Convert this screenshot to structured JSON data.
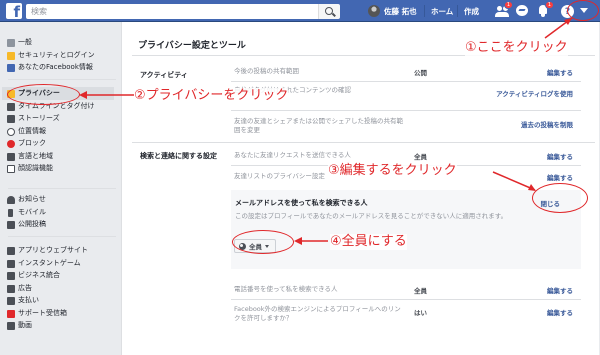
{
  "topbar": {
    "search_placeholder": "検索",
    "user_name": "佐藤 拓也",
    "home": "ホーム",
    "create": "作成",
    "friend_badge": "1",
    "notif_badge": "1",
    "help": "?"
  },
  "sidebar": {
    "group1": [
      "一般",
      "セキュリティとログイン",
      "あなたのFacebook情報"
    ],
    "group2": [
      "プライバシー",
      "タイムラインとタグ付け",
      "ストーリーズ",
      "位置情報",
      "ブロック",
      "言語と地域",
      "顔認識機能"
    ],
    "group3": [
      "お知らせ",
      "モバイル",
      "公開投稿"
    ],
    "group4": [
      "アプリとウェブサイト",
      "インスタントゲーム",
      "ビジネス統合",
      "広告",
      "支払い",
      "サポート受信箱",
      "動画"
    ]
  },
  "main": {
    "title": "プライバシー設定とツール",
    "activity": {
      "label": "アクティビティ",
      "rows": [
        {
          "q": "今後の投稿の共有範囲",
          "v": "公開",
          "a": "編集する"
        },
        {
          "q": "自分がタグ付けされたコンテンツの確認",
          "v": "",
          "a": "アクティビティログを使用"
        },
        {
          "q": "友達の友達とシェアまたは公開でシェアした投稿の共有範囲を変更",
          "v": "",
          "a": "過去の投稿を制限"
        }
      ]
    },
    "search_contact": {
      "label": "検索と連絡に関する設定",
      "rows": [
        {
          "q": "あなたに友達リクエストを送信できる人",
          "v": "全員",
          "a": "編集する"
        },
        {
          "q": "友達リストのプライバシー設定",
          "v": "",
          "a": "編集する"
        }
      ],
      "expanded": {
        "title": "メールアドレスを使って私を検索できる人",
        "desc": "この設定はプロフィールであなたのメールアドレスを見ることができない人に適用されます。",
        "close": "閉じる",
        "selected": "全員"
      },
      "rows_after": [
        {
          "q": "電話番号を使って私を検索できる人",
          "v": "全員",
          "a": "編集する"
        },
        {
          "q": "Facebook外の検索エンジンによるプロフィールへのリンクを許可しますか？",
          "v": "はい",
          "a": "編集する"
        }
      ]
    }
  },
  "annotations": {
    "a1": "①ここをクリック",
    "a2": "②プライバシーをクリック",
    "a3": "③編集するをクリック",
    "a4": "④全員にする"
  },
  "colors": {
    "brand": "#4267b2",
    "annotation": "#e0282b",
    "link": "#385898"
  }
}
